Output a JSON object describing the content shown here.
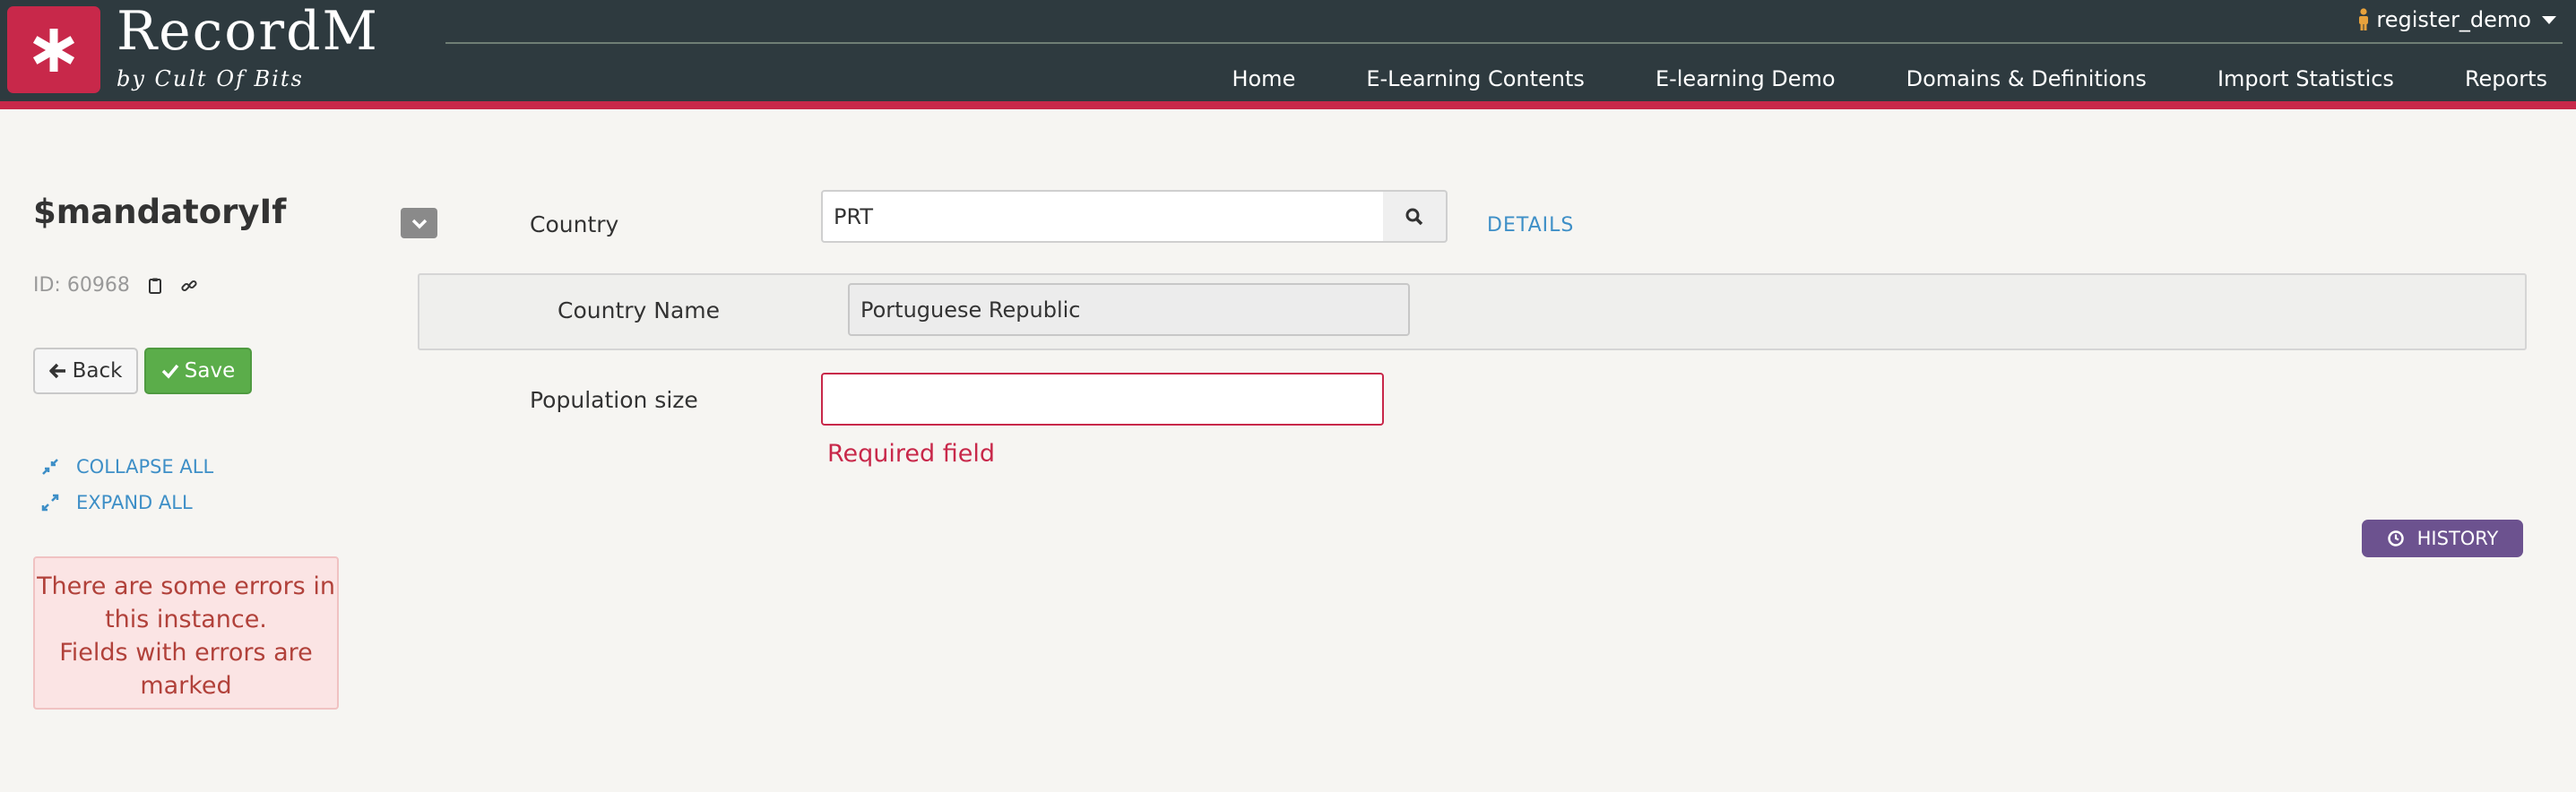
{
  "header": {
    "brand": "RecordM",
    "brand_sub": "by Cult Of Bits",
    "user": "register_demo",
    "nav": [
      "Home",
      "E-Learning Contents",
      "E-learning Demo",
      "Domains & Definitions",
      "Import Statistics",
      "Reports"
    ]
  },
  "sidebar": {
    "title": "$mandatoryIf",
    "id_label": "ID: 60968",
    "back_label": "Back",
    "save_label": "Save",
    "collapse_all": "COLLAPSE ALL",
    "expand_all": "EXPAND ALL",
    "error_lines": [
      "There are some errors in",
      "this instance.",
      "Fields with errors are",
      "marked"
    ]
  },
  "form": {
    "country_label": "Country",
    "country_value": "PRT",
    "details_label": "DETAILS",
    "country_name_label": "Country Name",
    "country_name_value": "Portuguese Republic",
    "population_label": "Population size",
    "population_value": "",
    "required_msg": "Required field",
    "history_label": "HISTORY"
  },
  "colors": {
    "header_bg": "#2e3a3f",
    "brand_red": "#c8284a",
    "save_green": "#5bad4a",
    "link_blue": "#3e8fc7",
    "history_purple": "#6c528f",
    "error_text": "#b1413a"
  },
  "icons": [
    "asterisk-icon",
    "person-icon",
    "caret-down-icon",
    "clipboard-icon",
    "link-icon",
    "arrow-left-icon",
    "check-icon",
    "compress-icon",
    "expand-icon",
    "chevron-down-icon",
    "search-icon",
    "clock-icon"
  ]
}
